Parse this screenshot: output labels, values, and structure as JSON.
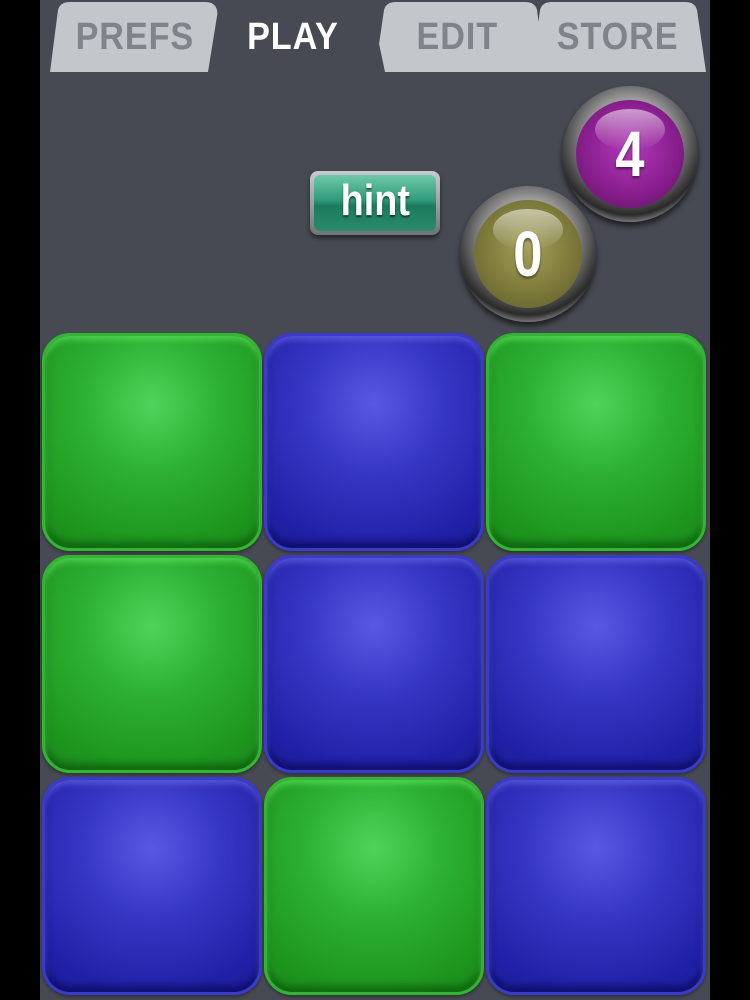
{
  "tabs": [
    {
      "label": "PREFS",
      "active": false
    },
    {
      "label": "PLAY",
      "active": true
    },
    {
      "label": "EDIT",
      "active": false
    },
    {
      "label": "STORE",
      "active": false
    }
  ],
  "hint_button": {
    "label": "hint"
  },
  "counters": {
    "purple_value": "4",
    "gold_value": "0"
  },
  "grid": {
    "rows": 3,
    "cols": 3,
    "cells": [
      "green",
      "blue",
      "green",
      "green",
      "blue",
      "blue",
      "blue",
      "green",
      "blue"
    ]
  },
  "colors": {
    "background": "#474a52",
    "tab_inactive": "#c3c6ca",
    "tab_active": "#474a52",
    "tile_green": "#2cb032",
    "tile_blue": "#3636c4",
    "badge_purple": "#8a1f8f",
    "badge_gold": "#7d7a3a",
    "hint_green": "#2f9b7a"
  }
}
